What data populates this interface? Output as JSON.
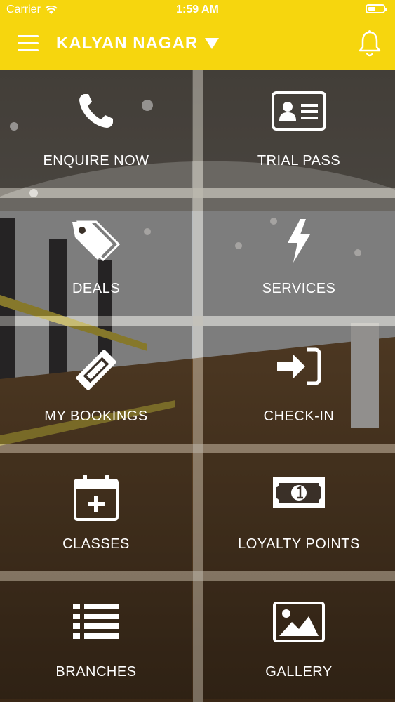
{
  "status_bar": {
    "carrier": "Carrier",
    "time": "1:59 AM"
  },
  "header": {
    "location": "KALYAN NAGAR",
    "accent_color": "#f6d60e"
  },
  "tiles": [
    {
      "label": "ENQUIRE NOW",
      "icon": "phone-icon"
    },
    {
      "label": "TRIAL PASS",
      "icon": "id-card-icon"
    },
    {
      "label": "DEALS",
      "icon": "tags-icon"
    },
    {
      "label": "SERVICES",
      "icon": "lightning-icon"
    },
    {
      "label": "MY BOOKINGS",
      "icon": "ticket-icon"
    },
    {
      "label": "CHECK-IN",
      "icon": "sign-in-icon"
    },
    {
      "label": "CLASSES",
      "icon": "calendar-plus-icon"
    },
    {
      "label": "LOYALTY POINTS",
      "icon": "money-bill-icon"
    },
    {
      "label": "BRANCHES",
      "icon": "list-icon"
    },
    {
      "label": "GALLERY",
      "icon": "image-icon"
    }
  ]
}
